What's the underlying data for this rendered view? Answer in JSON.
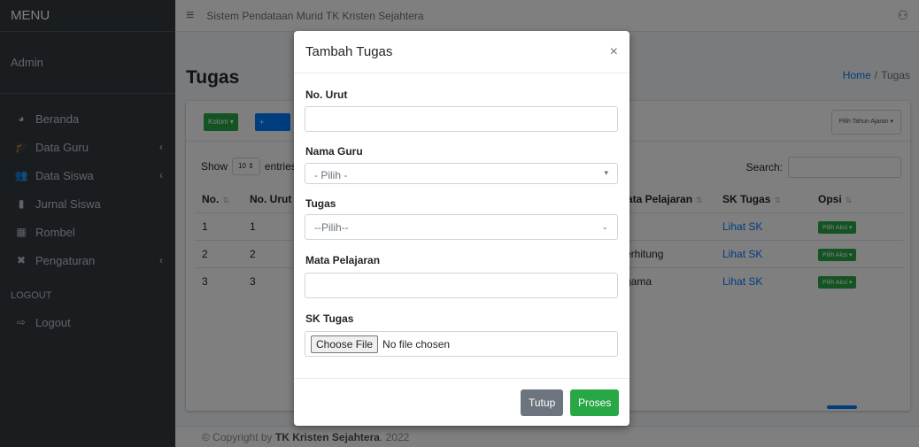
{
  "sidebar": {
    "brand": "MENU",
    "user": "Admin",
    "items": [
      {
        "icon": "tachometer-icon",
        "glyph": "◕",
        "label": "Beranda",
        "chev": ""
      },
      {
        "icon": "graduation-cap-icon",
        "glyph": "🎓",
        "label": "Data Guru",
        "chev": "‹"
      },
      {
        "icon": "users-icon",
        "glyph": "👥",
        "label": "Data Siswa",
        "chev": "‹"
      },
      {
        "icon": "book-icon",
        "glyph": "▮",
        "label": "Jurnal Siswa",
        "chev": ""
      },
      {
        "icon": "building-icon",
        "glyph": "▦",
        "label": "Rombel",
        "chev": ""
      },
      {
        "icon": "tools-icon",
        "glyph": "✖",
        "label": "Pengaturan",
        "chev": "‹"
      }
    ],
    "section": "LOGOUT",
    "logout": "Logout"
  },
  "navbar": {
    "menu_glyph": "≡",
    "title": "Sistem Pendataan Murid TK Kristen Sejahtera",
    "user_glyph": "⚇"
  },
  "page": {
    "title": "Tugas",
    "breadcrumb_home": "Home",
    "breadcrumb_sep": "/",
    "breadcrumb_current": "Tugas"
  },
  "toolbar": {
    "kolom": "Kolom ▾",
    "tambah": "+ Tambah",
    "tahun_ajaran": "Pilih Tahun Ajaran ▾"
  },
  "table_controls": {
    "show": "Show",
    "show_value": "10 ⇕",
    "entries": "entries",
    "search": "Search:"
  },
  "table": {
    "headers": [
      "No.",
      "No. Urut",
      "Mata Pelajaran",
      "SK Tugas",
      "Opsi"
    ],
    "rows": [
      {
        "no": "1",
        "urut": "1",
        "mapel": "-",
        "sk": "Lihat SK",
        "opsi": "Pilih Aksi ▾"
      },
      {
        "no": "2",
        "urut": "2",
        "mapel": "Berhitung",
        "sk": "Lihat SK",
        "opsi": "Pilih Aksi ▾"
      },
      {
        "no": "3",
        "urut": "3",
        "mapel": "Agama",
        "sk": "Lihat SK",
        "opsi": "Pilih Aksi ▾"
      }
    ]
  },
  "footer": {
    "prefix": "© Copyright by",
    "org": "TK Kristen Sejahtera",
    "year": ". 2022"
  },
  "modal": {
    "title": "Tambah Tugas",
    "close": "×",
    "fields": {
      "no_urut_label": "No. Urut",
      "no_urut_value": "",
      "nama_guru_label": "Nama Guru",
      "nama_guru_value": "- Pilih -",
      "tugas_label": "Tugas",
      "tugas_value": "--Pilih--",
      "mapel_label": "Mata Pelajaran",
      "mapel_value": "",
      "sk_label": "SK Tugas",
      "file_button": "Choose File",
      "file_status": "No file chosen"
    },
    "buttons": {
      "tutup": "Tutup",
      "proses": "Proses"
    }
  },
  "colors": {
    "sidebar": "#343a40",
    "primary": "#007bff",
    "success": "#28a745",
    "secondary": "#6c757d"
  }
}
